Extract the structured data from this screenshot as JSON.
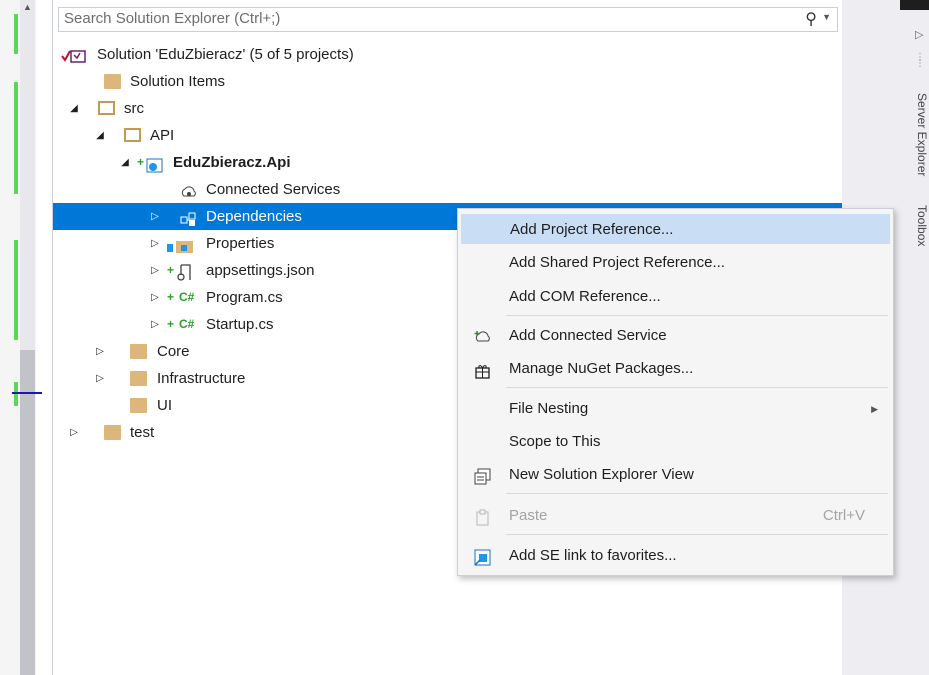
{
  "search": {
    "placeholder": "Search Solution Explorer (Ctrl+;)",
    "value": ""
  },
  "tree": {
    "solution": "Solution 'EduZbieracz' (5 of 5 projects)",
    "solution_items": "Solution Items",
    "src": "src",
    "api": "API",
    "project": "EduZbieracz.Api",
    "connected_services": "Connected Services",
    "dependencies": "Dependencies",
    "properties": "Properties",
    "appsettings": "appsettings.json",
    "program": "Program.cs",
    "startup": "Startup.cs",
    "core": "Core",
    "infrastructure": "Infrastructure",
    "ui": "UI",
    "test": "test"
  },
  "context_menu": {
    "add_project_reference": "Add Project Reference...",
    "add_shared_project_reference": "Add Shared Project Reference...",
    "add_com_reference": "Add COM Reference...",
    "add_connected_service": "Add Connected Service",
    "manage_nuget": "Manage NuGet Packages...",
    "file_nesting": "File Nesting",
    "scope_to_this": "Scope to This",
    "new_se_view": "New Solution Explorer View",
    "paste": "Paste",
    "paste_shortcut": "Ctrl+V",
    "add_se_link": "Add SE link to favorites..."
  },
  "side_tabs": {
    "server_explorer": "Server Explorer",
    "toolbox": "Toolbox"
  },
  "colors": {
    "selection": "#0078d7",
    "menu_hot": "#c9def5",
    "added_glyph": "#2ca02c",
    "folder": "#dcb67a"
  }
}
